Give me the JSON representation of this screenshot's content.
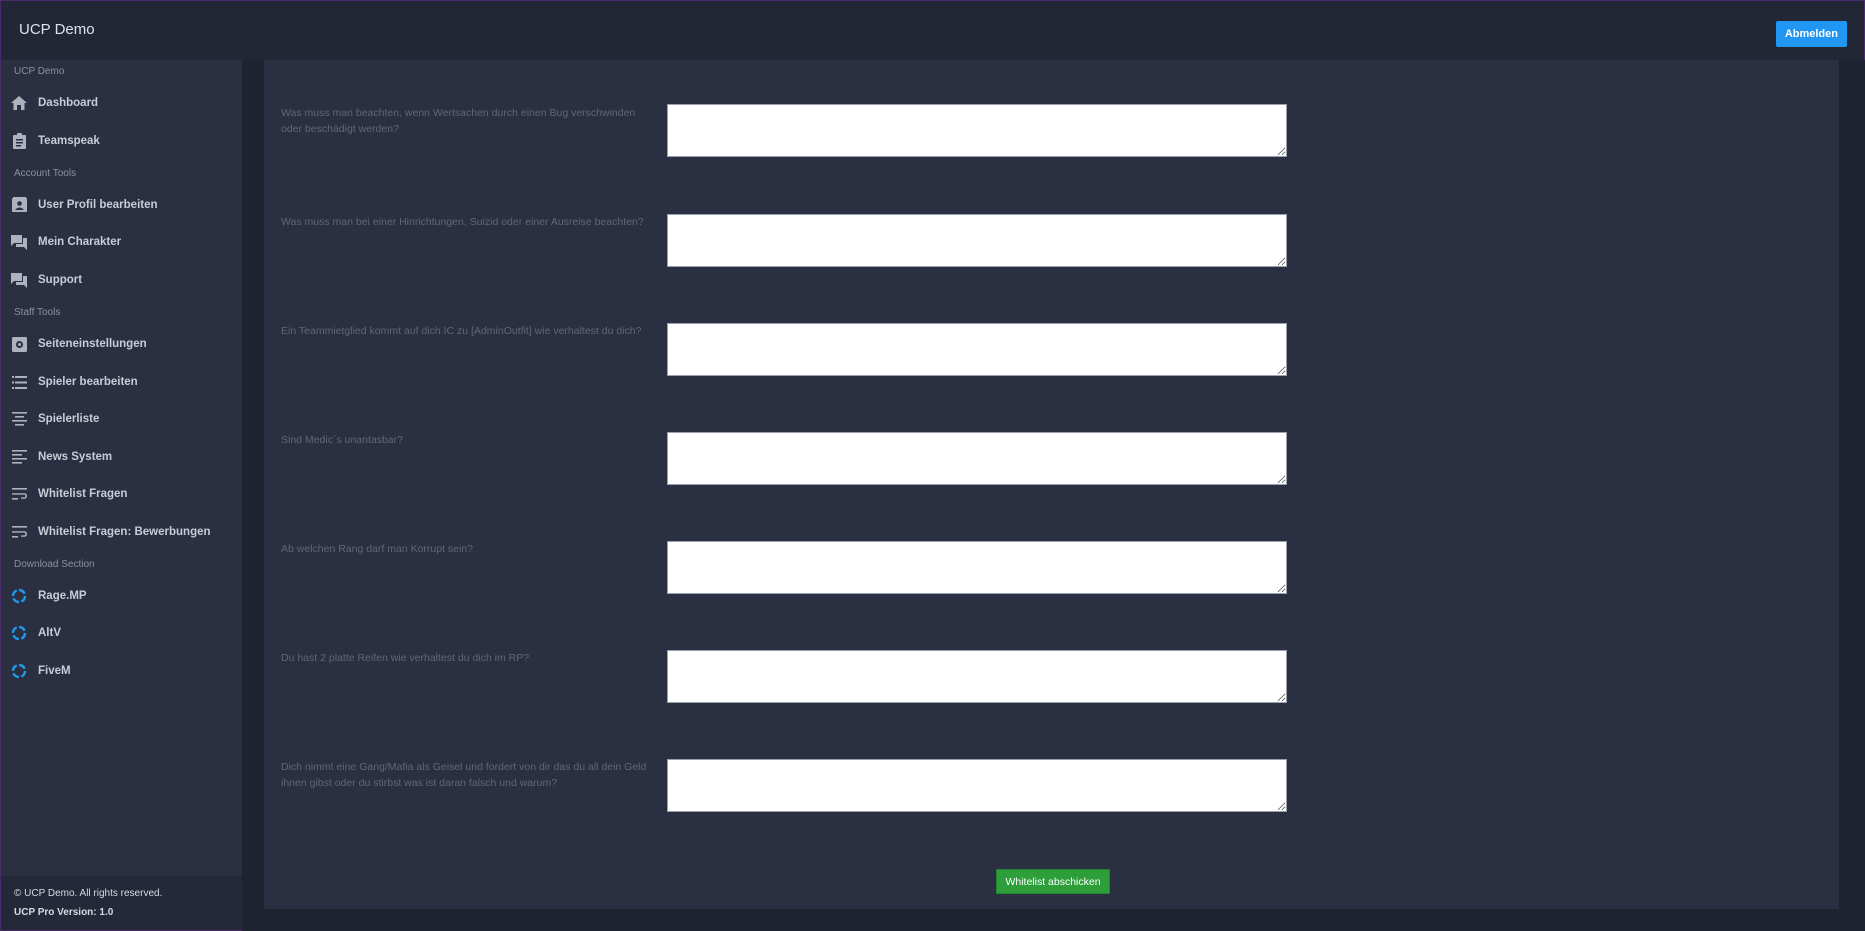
{
  "header": {
    "app_title": "UCP Demo",
    "logout_label": "Abmelden"
  },
  "sidebar": {
    "sections": [
      {
        "label": "UCP Demo"
      },
      {
        "label": "Account Tools"
      },
      {
        "label": "Staff Tools"
      },
      {
        "label": "Download Section"
      }
    ],
    "items": [
      {
        "label": "Dashboard",
        "icon": "home-icon"
      },
      {
        "label": "Teamspeak",
        "icon": "clipboard-icon"
      },
      {
        "label": "User Profil bearbeiten",
        "icon": "contact-card-icon"
      },
      {
        "label": "Mein Charakter",
        "icon": "chat-bubbles-icon"
      },
      {
        "label": "Support",
        "icon": "chat-bubbles-icon"
      },
      {
        "label": "Seiteneinstellungen",
        "icon": "settings-box-icon"
      },
      {
        "label": "Spieler bearbeiten",
        "icon": "list-icon"
      },
      {
        "label": "Spielerliste",
        "icon": "align-center-icon"
      },
      {
        "label": "News System",
        "icon": "align-left-icon"
      },
      {
        "label": "Whitelist Fragen",
        "icon": "wrap-text-icon"
      },
      {
        "label": "Whitelist Fragen: Bewerbungen",
        "icon": "wrap-text-icon"
      },
      {
        "label": "Rage.MP",
        "icon": "loading-ring-icon"
      },
      {
        "label": "AltV",
        "icon": "loading-ring-icon"
      },
      {
        "label": "FiveM",
        "icon": "loading-ring-icon"
      }
    ],
    "footer": {
      "copyright": "© UCP Demo. All rights reserved.",
      "version": "UCP Pro Version: 1.0"
    }
  },
  "form": {
    "questions": [
      {
        "text": "Was muss man beachten, wenn Wertsachen durch einen Bug verschwinden oder beschädigt werden?",
        "answer": ""
      },
      {
        "text": "Was muss man bei einer Hinrichtungen, Suizid oder einer Ausreise beachten?",
        "answer": ""
      },
      {
        "text": "Ein Teammietglied kommt auf dich IC zu [AdminOutfit] wie verhaltest du dich?",
        "answer": ""
      },
      {
        "text": "Sind Medic´s unantasbar?",
        "answer": ""
      },
      {
        "text": "Ab welchen Rang darf man Korrupt sein?",
        "answer": ""
      },
      {
        "text": "Du hast 2 platte Reifen wie verhaltest du dich im RP?",
        "answer": ""
      },
      {
        "text": "Dich nimmt eine Gang/Mafia als Geisel und fordert von dir das du all dein Geld ihnen gibst oder du stirbst was ist daran falsch und warum?",
        "answer": ""
      }
    ],
    "submit_label": "Whitelist abschicken"
  },
  "colors": {
    "accent_blue": "#2196f3",
    "submit_green": "#2e9e3b",
    "sidebar_bg": "#2a2f42",
    "page_bg": "#1f2330",
    "ring_icon": "#1e9be9"
  }
}
